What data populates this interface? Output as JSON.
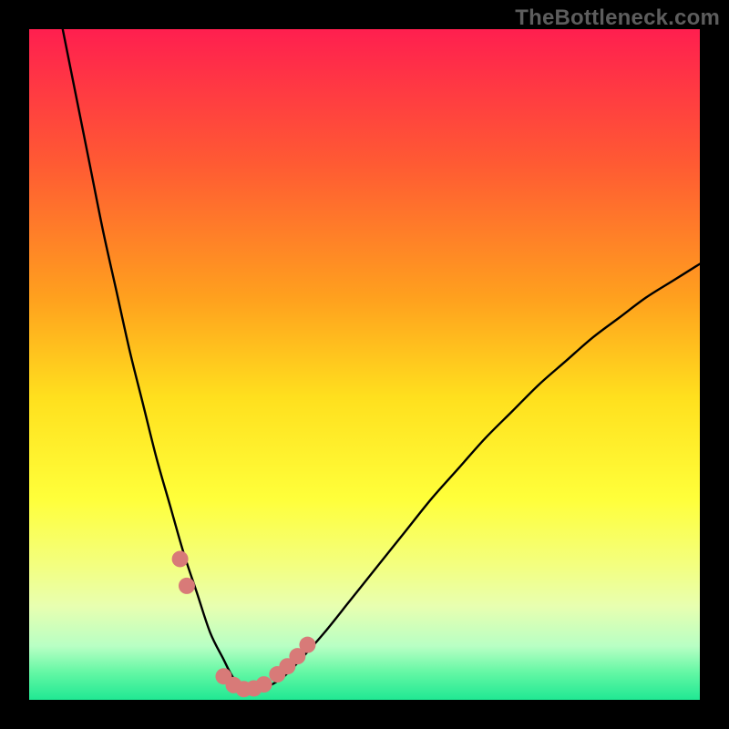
{
  "watermark": "TheBottleneck.com",
  "colors": {
    "frame": "#000000",
    "curve": "#000000",
    "markers": "#d87a78",
    "gradient_stops": [
      {
        "offset": 0.0,
        "color": "#ff1f4f"
      },
      {
        "offset": 0.2,
        "color": "#ff5a33"
      },
      {
        "offset": 0.4,
        "color": "#ffa01e"
      },
      {
        "offset": 0.55,
        "color": "#ffe01e"
      },
      {
        "offset": 0.7,
        "color": "#ffff3a"
      },
      {
        "offset": 0.8,
        "color": "#f3ff80"
      },
      {
        "offset": 0.86,
        "color": "#e8ffb0"
      },
      {
        "offset": 0.92,
        "color": "#b8ffc4"
      },
      {
        "offset": 0.96,
        "color": "#62f7a4"
      },
      {
        "offset": 1.0,
        "color": "#20e893"
      }
    ]
  },
  "chart_data": {
    "type": "line",
    "title": "",
    "xlabel": "",
    "ylabel": "",
    "xlim": [
      0,
      100
    ],
    "ylim": [
      0,
      100
    ],
    "series": [
      {
        "name": "bottleneck-curve",
        "x": [
          5,
          7,
          9,
          11,
          13,
          15,
          17,
          19,
          21,
          23,
          25,
          27,
          29,
          30,
          31,
          32,
          33,
          34,
          36,
          38,
          40,
          44,
          48,
          52,
          56,
          60,
          64,
          68,
          72,
          76,
          80,
          84,
          88,
          92,
          96,
          100
        ],
        "y": [
          100,
          90,
          80,
          70,
          61,
          52,
          44,
          36,
          29,
          22,
          16,
          10,
          6,
          4,
          2.5,
          1.8,
          1.5,
          1.6,
          2.2,
          3.5,
          5.5,
          10,
          15,
          20,
          25,
          30,
          34.5,
          39,
          43,
          47,
          50.5,
          54,
          57,
          60,
          62.5,
          65
        ]
      }
    ],
    "markers": [
      {
        "x": 22.5,
        "y": 21
      },
      {
        "x": 23.5,
        "y": 17
      },
      {
        "x": 29.0,
        "y": 3.5
      },
      {
        "x": 30.5,
        "y": 2.2
      },
      {
        "x": 32.0,
        "y": 1.6
      },
      {
        "x": 33.5,
        "y": 1.7
      },
      {
        "x": 35.0,
        "y": 2.3
      },
      {
        "x": 37.0,
        "y": 3.8
      },
      {
        "x": 38.5,
        "y": 5.0
      },
      {
        "x": 40.0,
        "y": 6.5
      },
      {
        "x": 41.5,
        "y": 8.2
      }
    ],
    "marker_radius_px": 9
  }
}
